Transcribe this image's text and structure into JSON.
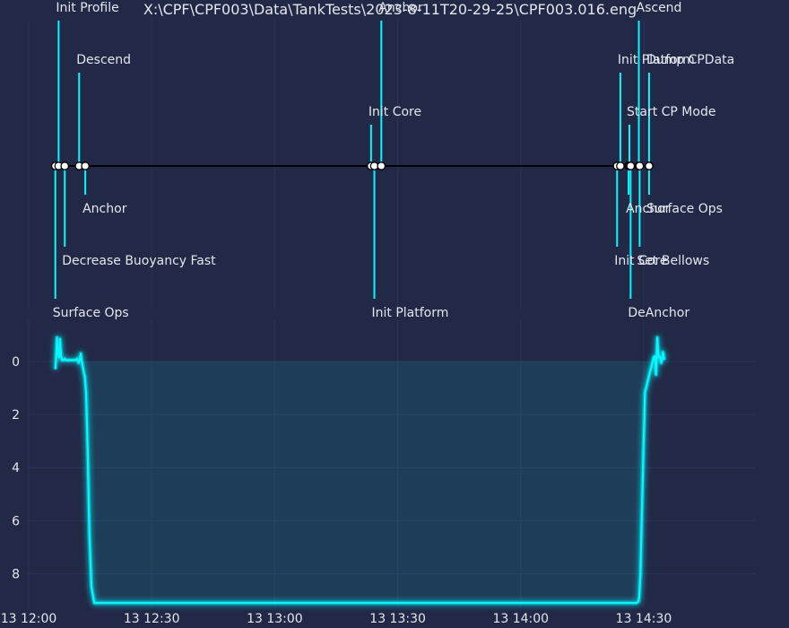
{
  "title": "X:\\CPF\\CPF003\\Data\\TankTests\\2023-8-11T20-29-25\\CPF003.016.eng",
  "colors": {
    "background": "#212946",
    "accent": "#08F7FE",
    "timeline": "#000000",
    "marker_fill": "#ffffff",
    "grid": "#2A3459",
    "text": "#e4e6ee"
  },
  "chart_data": [
    {
      "type": "timeline",
      "x_unit": "minutes since 13 12:00",
      "events": [
        {
          "t": 6.5,
          "label": "Surface Ops",
          "side": "below",
          "tier": 3
        },
        {
          "t": 7.3,
          "label": "Init Profile",
          "side": "above",
          "tier": 3
        },
        {
          "t": 8.8,
          "label": "Decrease Buoyancy Fast",
          "side": "below",
          "tier": 2
        },
        {
          "t": 12.3,
          "label": "Descend",
          "side": "above",
          "tier": 2
        },
        {
          "t": 13.8,
          "label": "Anchor",
          "side": "below",
          "tier": 1
        },
        {
          "t": 83.5,
          "label": "Init Core",
          "side": "above",
          "tier": 1
        },
        {
          "t": 84.3,
          "label": "Init Platform",
          "side": "below",
          "tier": 3
        },
        {
          "t": 86.0,
          "label": "Anchor",
          "side": "above",
          "tier": 3
        },
        {
          "t": 143.5,
          "label": "Init Core",
          "side": "below",
          "tier": 2
        },
        {
          "t": 144.3,
          "label": "Init Platform",
          "side": "above",
          "tier": 2
        },
        {
          "t": 146.3,
          "label": "Anchor",
          "side": "below",
          "tier": 1
        },
        {
          "t": 146.5,
          "label": "Start CP Mode",
          "side": "above",
          "tier": 1
        },
        {
          "t": 146.8,
          "label": "DeAnchor",
          "side": "below",
          "tier": 3
        },
        {
          "t": 148.8,
          "label": "Ascend",
          "side": "above",
          "tier": 3
        },
        {
          "t": 149.0,
          "label": "Set Bellows",
          "side": "below",
          "tier": 2
        },
        {
          "t": 151.3,
          "label": "Dump CPData",
          "side": "above",
          "tier": 2
        },
        {
          "t": 151.3,
          "label": "Surface Ops",
          "side": "below",
          "tier": 1
        }
      ]
    },
    {
      "type": "area",
      "x_unit": "minutes since 13 12:00",
      "y_inverted": true,
      "ylim": [
        9.3,
        -1.55
      ],
      "y_ticks": [
        0,
        2,
        4,
        6,
        8
      ],
      "x_ticks": [
        {
          "t": 0,
          "label": "13 12:00"
        },
        {
          "t": 30,
          "label": "13 12:30"
        },
        {
          "t": 60,
          "label": "13 13:00"
        },
        {
          "t": 90,
          "label": "13 13:30"
        },
        {
          "t": 120,
          "label": "13 14:00"
        },
        {
          "t": 150,
          "label": "13 14:30"
        }
      ],
      "x": [
        6.5,
        6.7,
        6.9,
        7.1,
        7.4,
        7.6,
        7.9,
        8.2,
        8.5,
        8.8,
        9.1,
        9.4,
        9.8,
        10.4,
        10.8,
        11.4,
        11.8,
        12.2,
        12.4,
        12.7,
        13.0,
        13.3,
        13.7,
        14.0,
        14.4,
        14.8,
        15.3,
        16.0,
        50.0,
        100.0,
        140.0,
        147.0,
        148.2,
        148.7,
        148.9,
        149.2,
        149.5,
        149.9,
        150.3,
        150.6,
        150.9,
        151.2,
        151.5,
        151.8,
        152.1,
        152.4,
        152.7,
        153.0,
        153.3,
        153.6,
        153.9,
        154.3,
        154.7,
        155.0
      ],
      "y": [
        0.3,
        -0.2,
        -0.9,
        -0.3,
        -0.15,
        -0.85,
        -0.2,
        -0.05,
        -0.05,
        -0.1,
        -0.05,
        -0.05,
        -0.05,
        -0.05,
        -0.05,
        -0.05,
        -0.1,
        0.05,
        -0.05,
        -0.3,
        0.05,
        0.3,
        0.6,
        1.2,
        3.5,
        6.5,
        8.5,
        9.1,
        9.1,
        9.1,
        9.1,
        9.1,
        9.1,
        9.05,
        8.9,
        8.0,
        6.0,
        3.5,
        1.15,
        1.0,
        0.8,
        0.6,
        0.4,
        0.25,
        0.05,
        -0.15,
        -0.2,
        0.5,
        -0.9,
        -0.15,
        -0.2,
        0.05,
        -0.35,
        -0.05
      ]
    }
  ]
}
